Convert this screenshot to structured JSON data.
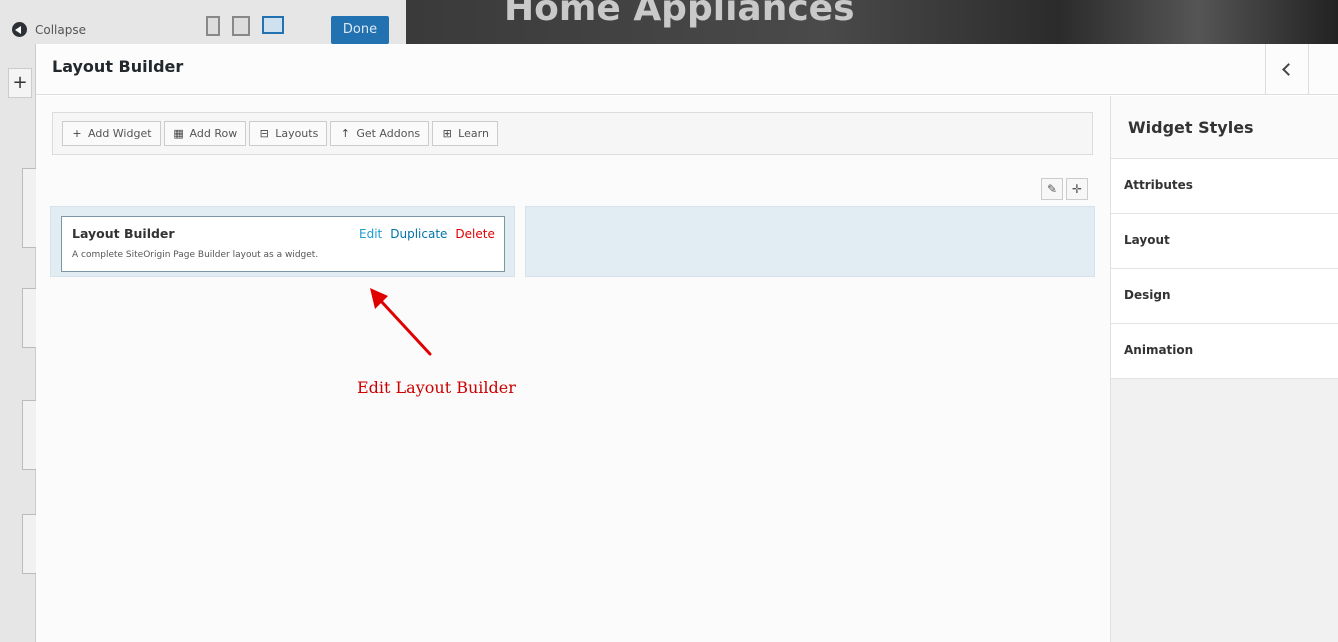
{
  "customizer": {
    "collapse_label": "Collapse",
    "done_label": "Done",
    "hero_title": "Home Appliances",
    "add_symbol": "+"
  },
  "modal": {
    "title": "Layout Builder"
  },
  "toolbar": {
    "buttons": [
      {
        "icon": "plus-icon",
        "glyph": "+",
        "label": "Add Widget"
      },
      {
        "icon": "grid-icon",
        "glyph": "▦",
        "label": "Add Row"
      },
      {
        "icon": "layouts-icon",
        "glyph": "⊟",
        "label": "Layouts"
      },
      {
        "icon": "arrow-up-icon",
        "glyph": "↑",
        "label": "Get Addons"
      },
      {
        "icon": "film-icon",
        "glyph": "⊞",
        "label": "Learn"
      }
    ]
  },
  "row_tools": {
    "wrench_glyph": "✎",
    "move_glyph": "✛"
  },
  "widget": {
    "title": "Layout Builder",
    "description": "A complete SiteOrigin Page Builder layout as a widget.",
    "edit_label": "Edit",
    "duplicate_label": "Duplicate",
    "delete_label": "Delete"
  },
  "annotation": {
    "text": "Edit Layout Builder",
    "color": "#cc0000"
  },
  "side_panel": {
    "title": "Widget Styles",
    "sections": [
      "Attributes",
      "Layout",
      "Design",
      "Animation"
    ]
  },
  "colors": {
    "accent": "#2271b1",
    "delete": "#dd0000",
    "link": "#0073aa",
    "cell_bg": "#e1edf3"
  }
}
